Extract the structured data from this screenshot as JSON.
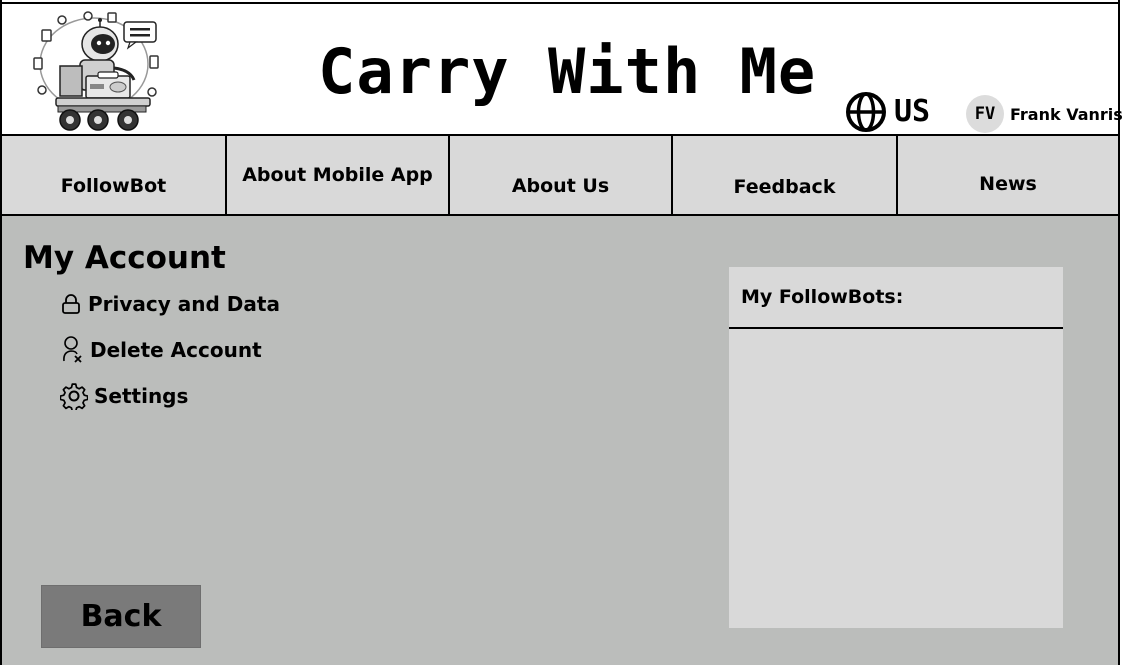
{
  "header": {
    "logo_badge": "CARRY WITH ME",
    "title": "Carry With Me",
    "locale": {
      "icon": "globe-icon",
      "label": "US"
    },
    "user": {
      "initials": "FV",
      "name": "Frank Vanris"
    }
  },
  "nav": {
    "items": [
      {
        "label": "FollowBot"
      },
      {
        "label": "About Mobile App"
      },
      {
        "label": "About Us"
      },
      {
        "label": "Feedback"
      },
      {
        "label": "News"
      }
    ]
  },
  "account": {
    "title": "My Account",
    "menu": [
      {
        "label": "Privacy and Data",
        "icon": "lock-icon"
      },
      {
        "label": "Delete Account",
        "icon": "user-remove-icon"
      },
      {
        "label": "Settings",
        "icon": "gear-icon"
      }
    ],
    "back_label": "Back"
  },
  "followbots": {
    "title": "My FollowBots:",
    "items": []
  },
  "colors": {
    "main_bg": "#bbbdbb",
    "nav_bg": "#d9d9d9",
    "panel_bg": "#d9d9d9",
    "back_button": "#7a7a7a"
  }
}
